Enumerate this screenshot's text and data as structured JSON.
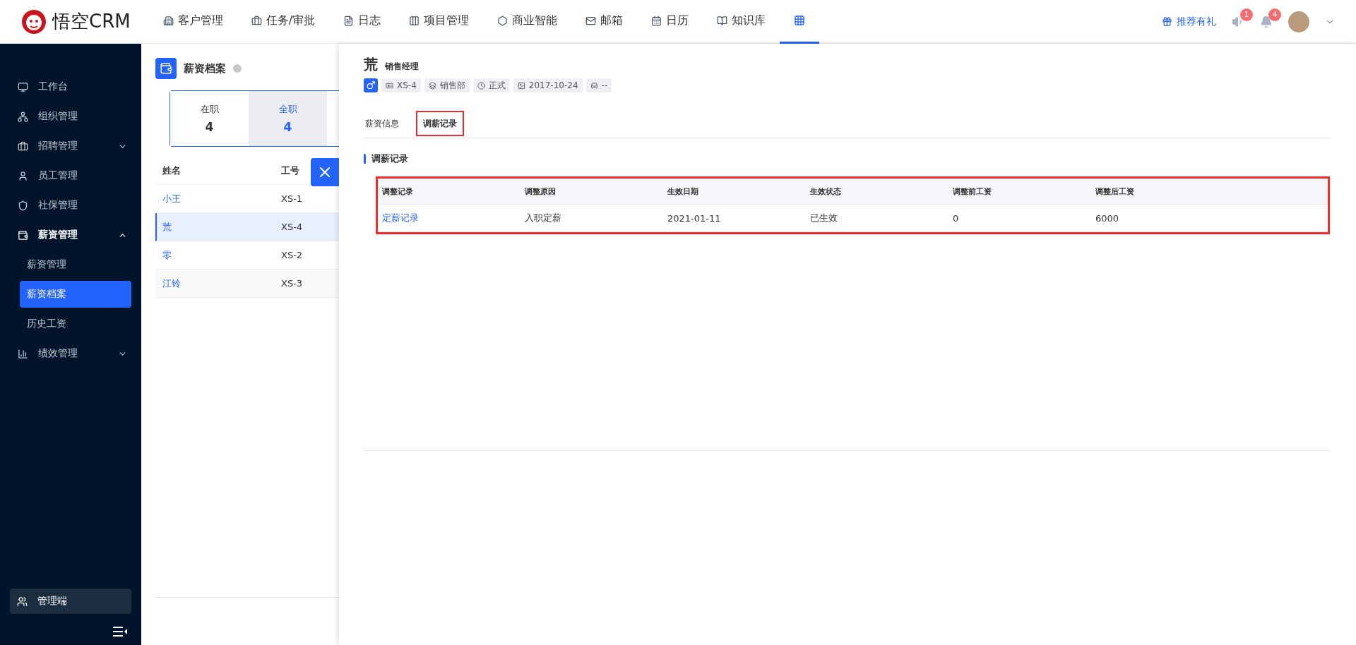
{
  "topbar": {
    "logo": "悟空CRM",
    "nav": [
      {
        "label": "客户管理",
        "selected": false
      },
      {
        "label": "任务/审批",
        "selected": false
      },
      {
        "label": "日志",
        "selected": false
      },
      {
        "label": "项目管理",
        "selected": false
      },
      {
        "label": "商业智能",
        "selected": false
      },
      {
        "label": "邮箱",
        "selected": false
      },
      {
        "label": "日历",
        "selected": false
      },
      {
        "label": "知识库",
        "selected": false
      }
    ],
    "apps": {
      "selected": true
    },
    "referral": "推荐有礼",
    "badges": [
      "1",
      "4"
    ]
  },
  "sidebar": {
    "items": [
      {
        "label": "工作台",
        "selected": false
      },
      {
        "label": "组织管理",
        "selected": false
      },
      {
        "label": "招聘管理",
        "selected": false,
        "expanded": false
      },
      {
        "label": "员工管理",
        "selected": false
      },
      {
        "label": "社保管理",
        "selected": false
      },
      {
        "label": "薪资管理",
        "selected": true,
        "expanded": true,
        "children": [
          {
            "label": "薪资管理",
            "selected": false
          },
          {
            "label": "薪资档案",
            "selected": true
          },
          {
            "label": "历史工资",
            "selected": false
          }
        ]
      },
      {
        "label": "绩效管理",
        "selected": false,
        "expanded": false
      }
    ],
    "admin": "管理端"
  },
  "list_panel": {
    "title": "薪资档案",
    "stats": [
      {
        "label": "在职",
        "value": "4",
        "selected": false
      },
      {
        "label": "全职",
        "value": "4",
        "selected": true
      }
    ],
    "columns": [
      "姓名",
      "工号"
    ],
    "rows": [
      {
        "name": "小王",
        "number": "XS-1",
        "selected": false
      },
      {
        "name": "荒",
        "number": "XS-4",
        "selected": true
      },
      {
        "name": "零",
        "number": "XS-2",
        "selected": false
      },
      {
        "name": "江铃",
        "number": "XS-3",
        "selected": false
      }
    ]
  },
  "drawer": {
    "name": "荒",
    "position": "销售经理",
    "tags": [
      "XS-4",
      "销售部",
      "正式",
      "2017-10-24",
      "--"
    ],
    "tabs": [
      {
        "label": "薪资信息",
        "selected": false,
        "highlighted": false
      },
      {
        "label": "调薪记录",
        "selected": true,
        "highlighted": true
      }
    ],
    "section_title": "调薪记录",
    "table": {
      "highlighted": true,
      "columns": [
        "调整记录",
        "调整原因",
        "生效日期",
        "生效状态",
        "调整前工资",
        "调整后工资"
      ],
      "rows": [
        [
          "定薪记录",
          "入职定薪",
          "2021-01-11",
          "已生效",
          "0",
          "6000"
        ]
      ]
    }
  }
}
